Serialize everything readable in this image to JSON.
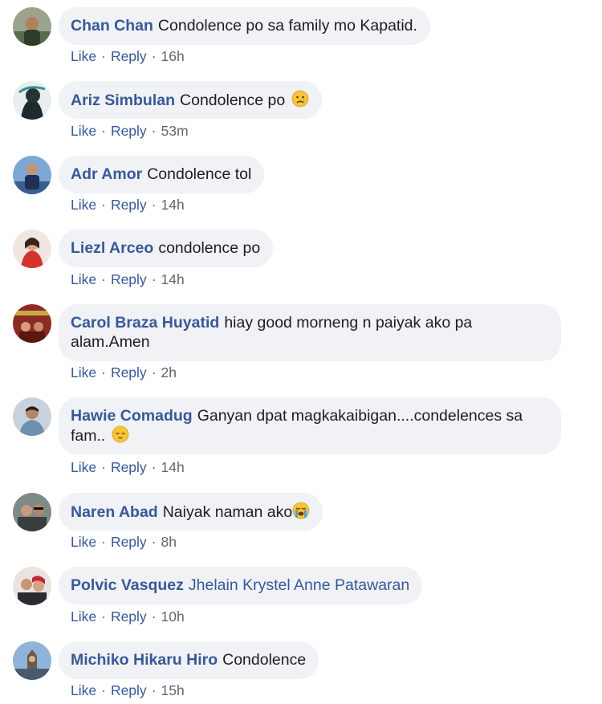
{
  "comments": [
    {
      "name": "Chan Chan",
      "text": "Condolence po sa family mo Kapatid.",
      "like": "Like",
      "reply": "Reply",
      "time": "16h"
    },
    {
      "name": "Ariz Simbulan",
      "text": "Condolence po",
      "emoji": "crying-face-icon",
      "like": "Like",
      "reply": "Reply",
      "time": "53m"
    },
    {
      "name": "Adr Amor",
      "text": "Condolence tol",
      "like": "Like",
      "reply": "Reply",
      "time": "14h"
    },
    {
      "name": "Liezl Arceo",
      "text": "condolence po",
      "like": "Like",
      "reply": "Reply",
      "time": "14h"
    },
    {
      "name": "Carol Braza Huyatid",
      "text": "hiay good morneng n paiyak ako pa alam.Amen",
      "like": "Like",
      "reply": "Reply",
      "time": "2h"
    },
    {
      "name": "Hawie Comadug",
      "text": "Ganyan dpat magkakaibigan....condelences sa fam..",
      "emoji": "pensive-face-icon",
      "like": "Like",
      "reply": "Reply",
      "time": "14h"
    },
    {
      "name": "Naren Abad",
      "text": "Naiyak naman ako",
      "emoji": "loudly-crying-face-icon",
      "like": "Like",
      "reply": "Reply",
      "time": "8h"
    },
    {
      "name": "Polvic Vasquez",
      "mention": "Jhelain Krystel Anne Patawaran",
      "like": "Like",
      "reply": "Reply",
      "time": "10h"
    },
    {
      "name": "Michiko Hikaru Hiro",
      "text": "Condolence",
      "like": "Like",
      "reply": "Reply",
      "time": "15h"
    }
  ],
  "colors": {
    "name_link": "#385898",
    "bubble_bg": "#f0f2f5",
    "meta": "#606770"
  }
}
